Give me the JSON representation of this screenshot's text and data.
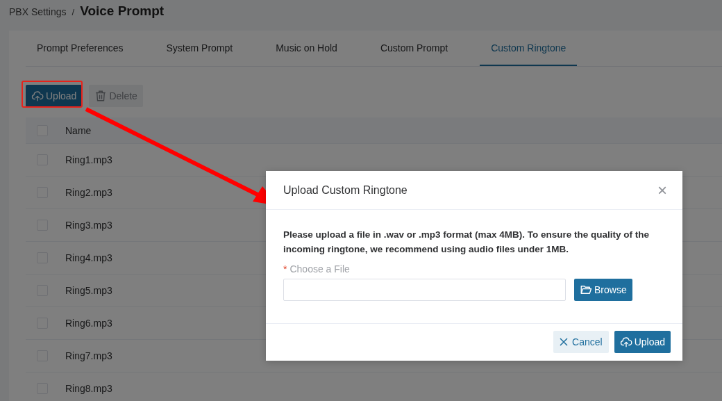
{
  "breadcrumb": {
    "parent": "PBX Settings",
    "separator": "/",
    "current": "Voice Prompt"
  },
  "tabs": [
    {
      "label": "Prompt Preferences",
      "selected": false
    },
    {
      "label": "System Prompt",
      "selected": false
    },
    {
      "label": "Music on Hold",
      "selected": false
    },
    {
      "label": "Custom Prompt",
      "selected": false
    },
    {
      "label": "Custom Ringtone",
      "selected": true
    }
  ],
  "toolbar": [
    {
      "kind": "upload",
      "label": "Upload",
      "disabled": false
    },
    {
      "kind": "delete",
      "label": "Delete",
      "disabled": true
    }
  ],
  "table": {
    "select_all_checked": false,
    "columns": [
      "Name"
    ],
    "rows": [
      {
        "name": "Ring1.mp3",
        "checked": false
      },
      {
        "name": "Ring2.mp3",
        "checked": false
      },
      {
        "name": "Ring3.mp3",
        "checked": false
      },
      {
        "name": "Ring4.mp3",
        "checked": false
      },
      {
        "name": "Ring5.mp3",
        "checked": false
      },
      {
        "name": "Ring6.mp3",
        "checked": false
      },
      {
        "name": "Ring7.mp3",
        "checked": false
      },
      {
        "name": "Ring8.mp3",
        "checked": false
      }
    ]
  },
  "dialog": {
    "title": "Upload Custom Ringtone",
    "close": "×",
    "message": "Please upload a file in .wav or .mp3 format (max 4MB). To ensure the quality of the incoming ringtone, we recommend using audio files under 1MB.",
    "field": {
      "label": "Choose a File",
      "required": true,
      "required_mark": "*"
    },
    "browse": "Browse",
    "cancel": "Cancel",
    "upload": "Upload"
  }
}
